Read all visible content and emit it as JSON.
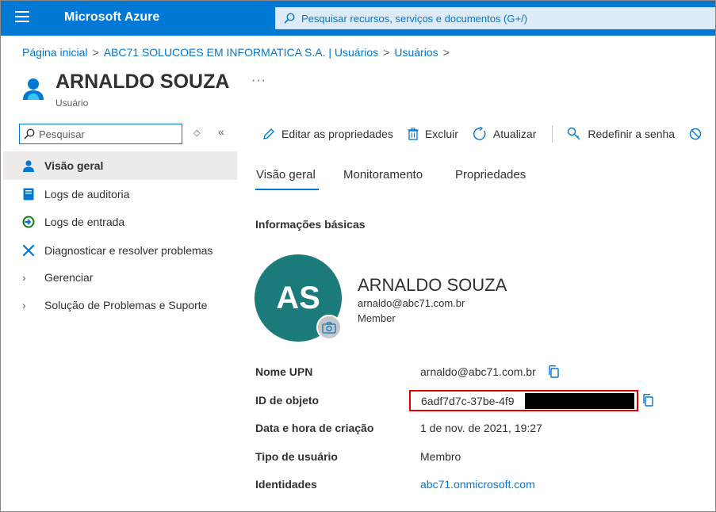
{
  "app": {
    "title": "Microsoft Azure",
    "search_placeholder": "Pesquisar recursos, serviços e documentos (G+/)"
  },
  "breadcrumb": {
    "items": [
      "Página inicial",
      "ABC71 SOLUCOES EM INFORMATICA S.A. | Usuários",
      "Usuários"
    ],
    "separator": ">"
  },
  "header": {
    "title": "ARNALDO SOUZA",
    "subtitle": "Usuário",
    "more": "···"
  },
  "nav": {
    "search_placeholder": "Pesquisar",
    "diamond": "◇",
    "collapse": "«",
    "items": [
      {
        "label": "Visão geral",
        "icon": "user-icon",
        "active": true
      },
      {
        "label": "Logs de auditoria",
        "icon": "audit-log-icon"
      },
      {
        "label": "Logs de entrada",
        "icon": "sign-in-log-icon"
      },
      {
        "label": "Diagnosticar e resolver problemas",
        "icon": "wrench-icon"
      },
      {
        "label": "Gerenciar",
        "icon": "chevron-right-icon"
      },
      {
        "label": "Solução de Problemas e Suporte",
        "icon": "chevron-right-icon"
      }
    ]
  },
  "toolbar": {
    "edit": "Editar as propriedades",
    "delete": "Excluir",
    "refresh": "Atualizar",
    "reset_password": "Redefinir a senha"
  },
  "tabs": [
    "Visão geral",
    "Monitoramento",
    "Propriedades"
  ],
  "section": {
    "title": "Informações básicas"
  },
  "profile": {
    "initials": "AS",
    "name": "ARNALDO SOUZA",
    "email": "arnaldo@abc71.com.br",
    "role": "Member"
  },
  "properties": [
    {
      "label": "Nome UPN",
      "value": "arnaldo@abc71.com.br"
    },
    {
      "label": "ID de objeto",
      "value": "6adf7d7c-37be-4f9"
    },
    {
      "label": "Data e hora de criação",
      "value": "1 de nov. de 2021, 19:27"
    },
    {
      "label": "Tipo de usuário",
      "value": "Membro"
    },
    {
      "label": "Identidades",
      "value": "abc71.onmicrosoft.com"
    }
  ],
  "colors": {
    "accent": "#0078d4",
    "avatar": "#1b7a7a",
    "highlight": "#e00000"
  }
}
